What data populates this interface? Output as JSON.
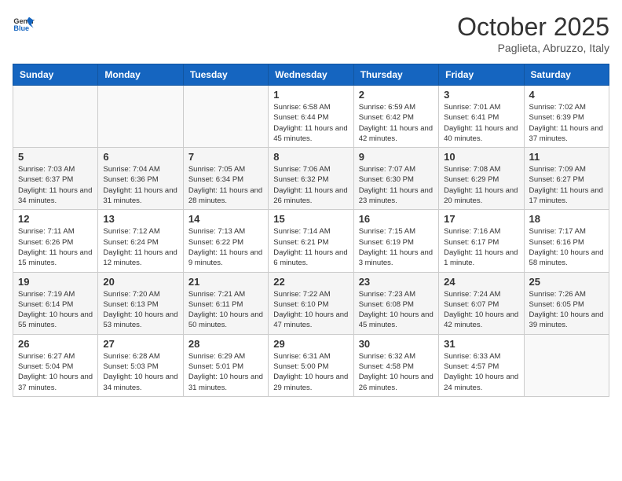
{
  "header": {
    "logo_general": "General",
    "logo_blue": "Blue",
    "month_title": "October 2025",
    "subtitle": "Paglieta, Abruzzo, Italy"
  },
  "days_of_week": [
    "Sunday",
    "Monday",
    "Tuesday",
    "Wednesday",
    "Thursday",
    "Friday",
    "Saturday"
  ],
  "weeks": [
    [
      {
        "day": "",
        "info": ""
      },
      {
        "day": "",
        "info": ""
      },
      {
        "day": "",
        "info": ""
      },
      {
        "day": "1",
        "info": "Sunrise: 6:58 AM\nSunset: 6:44 PM\nDaylight: 11 hours and 45 minutes."
      },
      {
        "day": "2",
        "info": "Sunrise: 6:59 AM\nSunset: 6:42 PM\nDaylight: 11 hours and 42 minutes."
      },
      {
        "day": "3",
        "info": "Sunrise: 7:01 AM\nSunset: 6:41 PM\nDaylight: 11 hours and 40 minutes."
      },
      {
        "day": "4",
        "info": "Sunrise: 7:02 AM\nSunset: 6:39 PM\nDaylight: 11 hours and 37 minutes."
      }
    ],
    [
      {
        "day": "5",
        "info": "Sunrise: 7:03 AM\nSunset: 6:37 PM\nDaylight: 11 hours and 34 minutes."
      },
      {
        "day": "6",
        "info": "Sunrise: 7:04 AM\nSunset: 6:36 PM\nDaylight: 11 hours and 31 minutes."
      },
      {
        "day": "7",
        "info": "Sunrise: 7:05 AM\nSunset: 6:34 PM\nDaylight: 11 hours and 28 minutes."
      },
      {
        "day": "8",
        "info": "Sunrise: 7:06 AM\nSunset: 6:32 PM\nDaylight: 11 hours and 26 minutes."
      },
      {
        "day": "9",
        "info": "Sunrise: 7:07 AM\nSunset: 6:30 PM\nDaylight: 11 hours and 23 minutes."
      },
      {
        "day": "10",
        "info": "Sunrise: 7:08 AM\nSunset: 6:29 PM\nDaylight: 11 hours and 20 minutes."
      },
      {
        "day": "11",
        "info": "Sunrise: 7:09 AM\nSunset: 6:27 PM\nDaylight: 11 hours and 17 minutes."
      }
    ],
    [
      {
        "day": "12",
        "info": "Sunrise: 7:11 AM\nSunset: 6:26 PM\nDaylight: 11 hours and 15 minutes."
      },
      {
        "day": "13",
        "info": "Sunrise: 7:12 AM\nSunset: 6:24 PM\nDaylight: 11 hours and 12 minutes."
      },
      {
        "day": "14",
        "info": "Sunrise: 7:13 AM\nSunset: 6:22 PM\nDaylight: 11 hours and 9 minutes."
      },
      {
        "day": "15",
        "info": "Sunrise: 7:14 AM\nSunset: 6:21 PM\nDaylight: 11 hours and 6 minutes."
      },
      {
        "day": "16",
        "info": "Sunrise: 7:15 AM\nSunset: 6:19 PM\nDaylight: 11 hours and 3 minutes."
      },
      {
        "day": "17",
        "info": "Sunrise: 7:16 AM\nSunset: 6:17 PM\nDaylight: 11 hours and 1 minute."
      },
      {
        "day": "18",
        "info": "Sunrise: 7:17 AM\nSunset: 6:16 PM\nDaylight: 10 hours and 58 minutes."
      }
    ],
    [
      {
        "day": "19",
        "info": "Sunrise: 7:19 AM\nSunset: 6:14 PM\nDaylight: 10 hours and 55 minutes."
      },
      {
        "day": "20",
        "info": "Sunrise: 7:20 AM\nSunset: 6:13 PM\nDaylight: 10 hours and 53 minutes."
      },
      {
        "day": "21",
        "info": "Sunrise: 7:21 AM\nSunset: 6:11 PM\nDaylight: 10 hours and 50 minutes."
      },
      {
        "day": "22",
        "info": "Sunrise: 7:22 AM\nSunset: 6:10 PM\nDaylight: 10 hours and 47 minutes."
      },
      {
        "day": "23",
        "info": "Sunrise: 7:23 AM\nSunset: 6:08 PM\nDaylight: 10 hours and 45 minutes."
      },
      {
        "day": "24",
        "info": "Sunrise: 7:24 AM\nSunset: 6:07 PM\nDaylight: 10 hours and 42 minutes."
      },
      {
        "day": "25",
        "info": "Sunrise: 7:26 AM\nSunset: 6:05 PM\nDaylight: 10 hours and 39 minutes."
      }
    ],
    [
      {
        "day": "26",
        "info": "Sunrise: 6:27 AM\nSunset: 5:04 PM\nDaylight: 10 hours and 37 minutes."
      },
      {
        "day": "27",
        "info": "Sunrise: 6:28 AM\nSunset: 5:03 PM\nDaylight: 10 hours and 34 minutes."
      },
      {
        "day": "28",
        "info": "Sunrise: 6:29 AM\nSunset: 5:01 PM\nDaylight: 10 hours and 31 minutes."
      },
      {
        "day": "29",
        "info": "Sunrise: 6:31 AM\nSunset: 5:00 PM\nDaylight: 10 hours and 29 minutes."
      },
      {
        "day": "30",
        "info": "Sunrise: 6:32 AM\nSunset: 4:58 PM\nDaylight: 10 hours and 26 minutes."
      },
      {
        "day": "31",
        "info": "Sunrise: 6:33 AM\nSunset: 4:57 PM\nDaylight: 10 hours and 24 minutes."
      },
      {
        "day": "",
        "info": ""
      }
    ]
  ]
}
